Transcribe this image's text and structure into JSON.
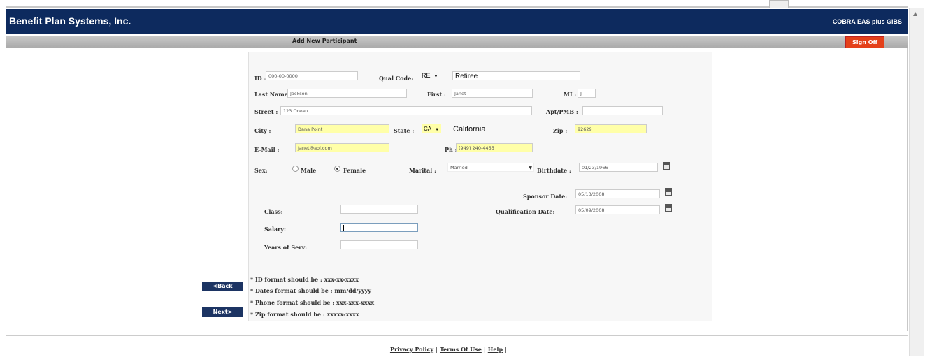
{
  "header": {
    "brand": "Benefit Plan Systems, Inc.",
    "module": "COBRA EAS plus GIBS"
  },
  "subbar": {
    "title": "Add New Participant",
    "sign_off": "Sign Off"
  },
  "form": {
    "id": {
      "label": "ID :",
      "value": "000-00-0000"
    },
    "qual_code": {
      "label": "Qual Code:",
      "value": "RE",
      "description": "Retiree"
    },
    "last_name": {
      "label": "Last Name :",
      "value": "Jackson"
    },
    "first": {
      "label": "First :",
      "value": "Janet"
    },
    "mi": {
      "label": "MI :",
      "value": "J"
    },
    "street": {
      "label": "Street :",
      "value": "123 Ocean"
    },
    "apt": {
      "label": "Apt/PMB :",
      "value": ""
    },
    "city": {
      "label": "City :",
      "value": "Dana Point"
    },
    "state": {
      "label": "State :",
      "value": "CA",
      "name": "California"
    },
    "zip": {
      "label": "Zip :",
      "value": "92629"
    },
    "email": {
      "label": "E-Mail :",
      "value": "Janet@aol.com"
    },
    "phone": {
      "label": "Ph :",
      "value": "(949) 240-4455"
    },
    "sex": {
      "label": "Sex:",
      "options": [
        "Male",
        "Female"
      ],
      "selected": "Female"
    },
    "marital": {
      "label": "Marital :",
      "value": "Married"
    },
    "birthdate": {
      "label": "Birthdate :",
      "value": "01/23/1966"
    },
    "sponsor_date": {
      "label": "Sponsor Date:",
      "value": "05/13/2008"
    },
    "qualification_date": {
      "label": "Qualification Date:",
      "value": "05/09/2008"
    },
    "class": {
      "label": "Class:",
      "value": ""
    },
    "salary": {
      "label": "Salary:",
      "value": ""
    },
    "years_serv": {
      "label": "Years of Serv:",
      "value": ""
    }
  },
  "buttons": {
    "back": "<Back",
    "next": "Next>"
  },
  "notes": [
    "* ID format should be : xxx-xx-xxxx",
    "* Dates format should be : mm/dd/yyyy",
    "* Phone format should be : xxx-xxx-xxxx",
    "* Zip format should be : xxxxx-xxxx"
  ],
  "footer": {
    "privacy": "Privacy Policy",
    "terms": "Terms Of Use",
    "help": "Help"
  },
  "colors": {
    "header_bg": "#0d2a5e",
    "sign_off_bg": "#e4401a",
    "highlight_field": "#ffffa8",
    "button_bg": "#1c3463"
  }
}
